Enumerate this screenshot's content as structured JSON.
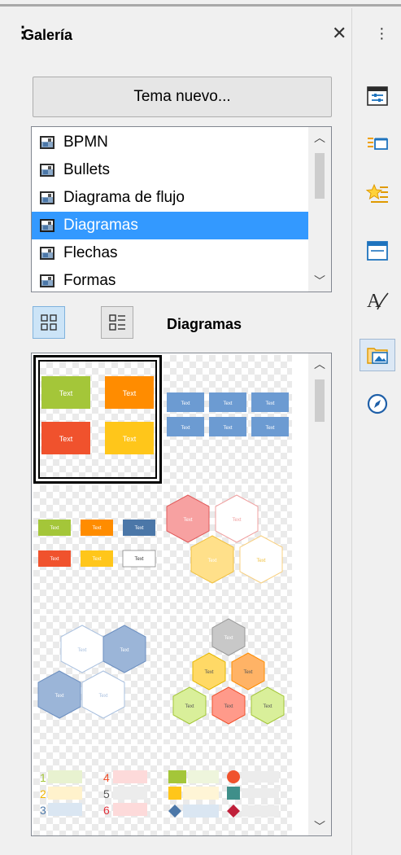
{
  "panel": {
    "title": "Galería",
    "new_theme_label": "Tema nuevo...",
    "view_label": "Diagramas"
  },
  "themes": [
    {
      "label": "BPMN",
      "selected": false
    },
    {
      "label": "Bullets",
      "selected": false
    },
    {
      "label": "Diagrama de flujo",
      "selected": false
    },
    {
      "label": "Diagramas",
      "selected": true
    },
    {
      "label": "Flechas",
      "selected": false
    },
    {
      "label": "Formas",
      "selected": false
    }
  ],
  "thumb_text": "Text",
  "thumb_number_labels": [
    "1",
    "2",
    "3",
    "4",
    "5",
    "6"
  ],
  "sidebar_tabs": [
    "properties-icon",
    "styles-icon",
    "star-list-icon",
    "slide-layout-icon",
    "text-style-icon",
    "gallery-icon",
    "navigator-icon"
  ],
  "colors": {
    "selection": "#3399ff",
    "green": "#a4c639",
    "orange": "#ff8c00",
    "red": "#f0522d",
    "yellow": "#ffc61a",
    "blue": "#5b8dc9"
  }
}
